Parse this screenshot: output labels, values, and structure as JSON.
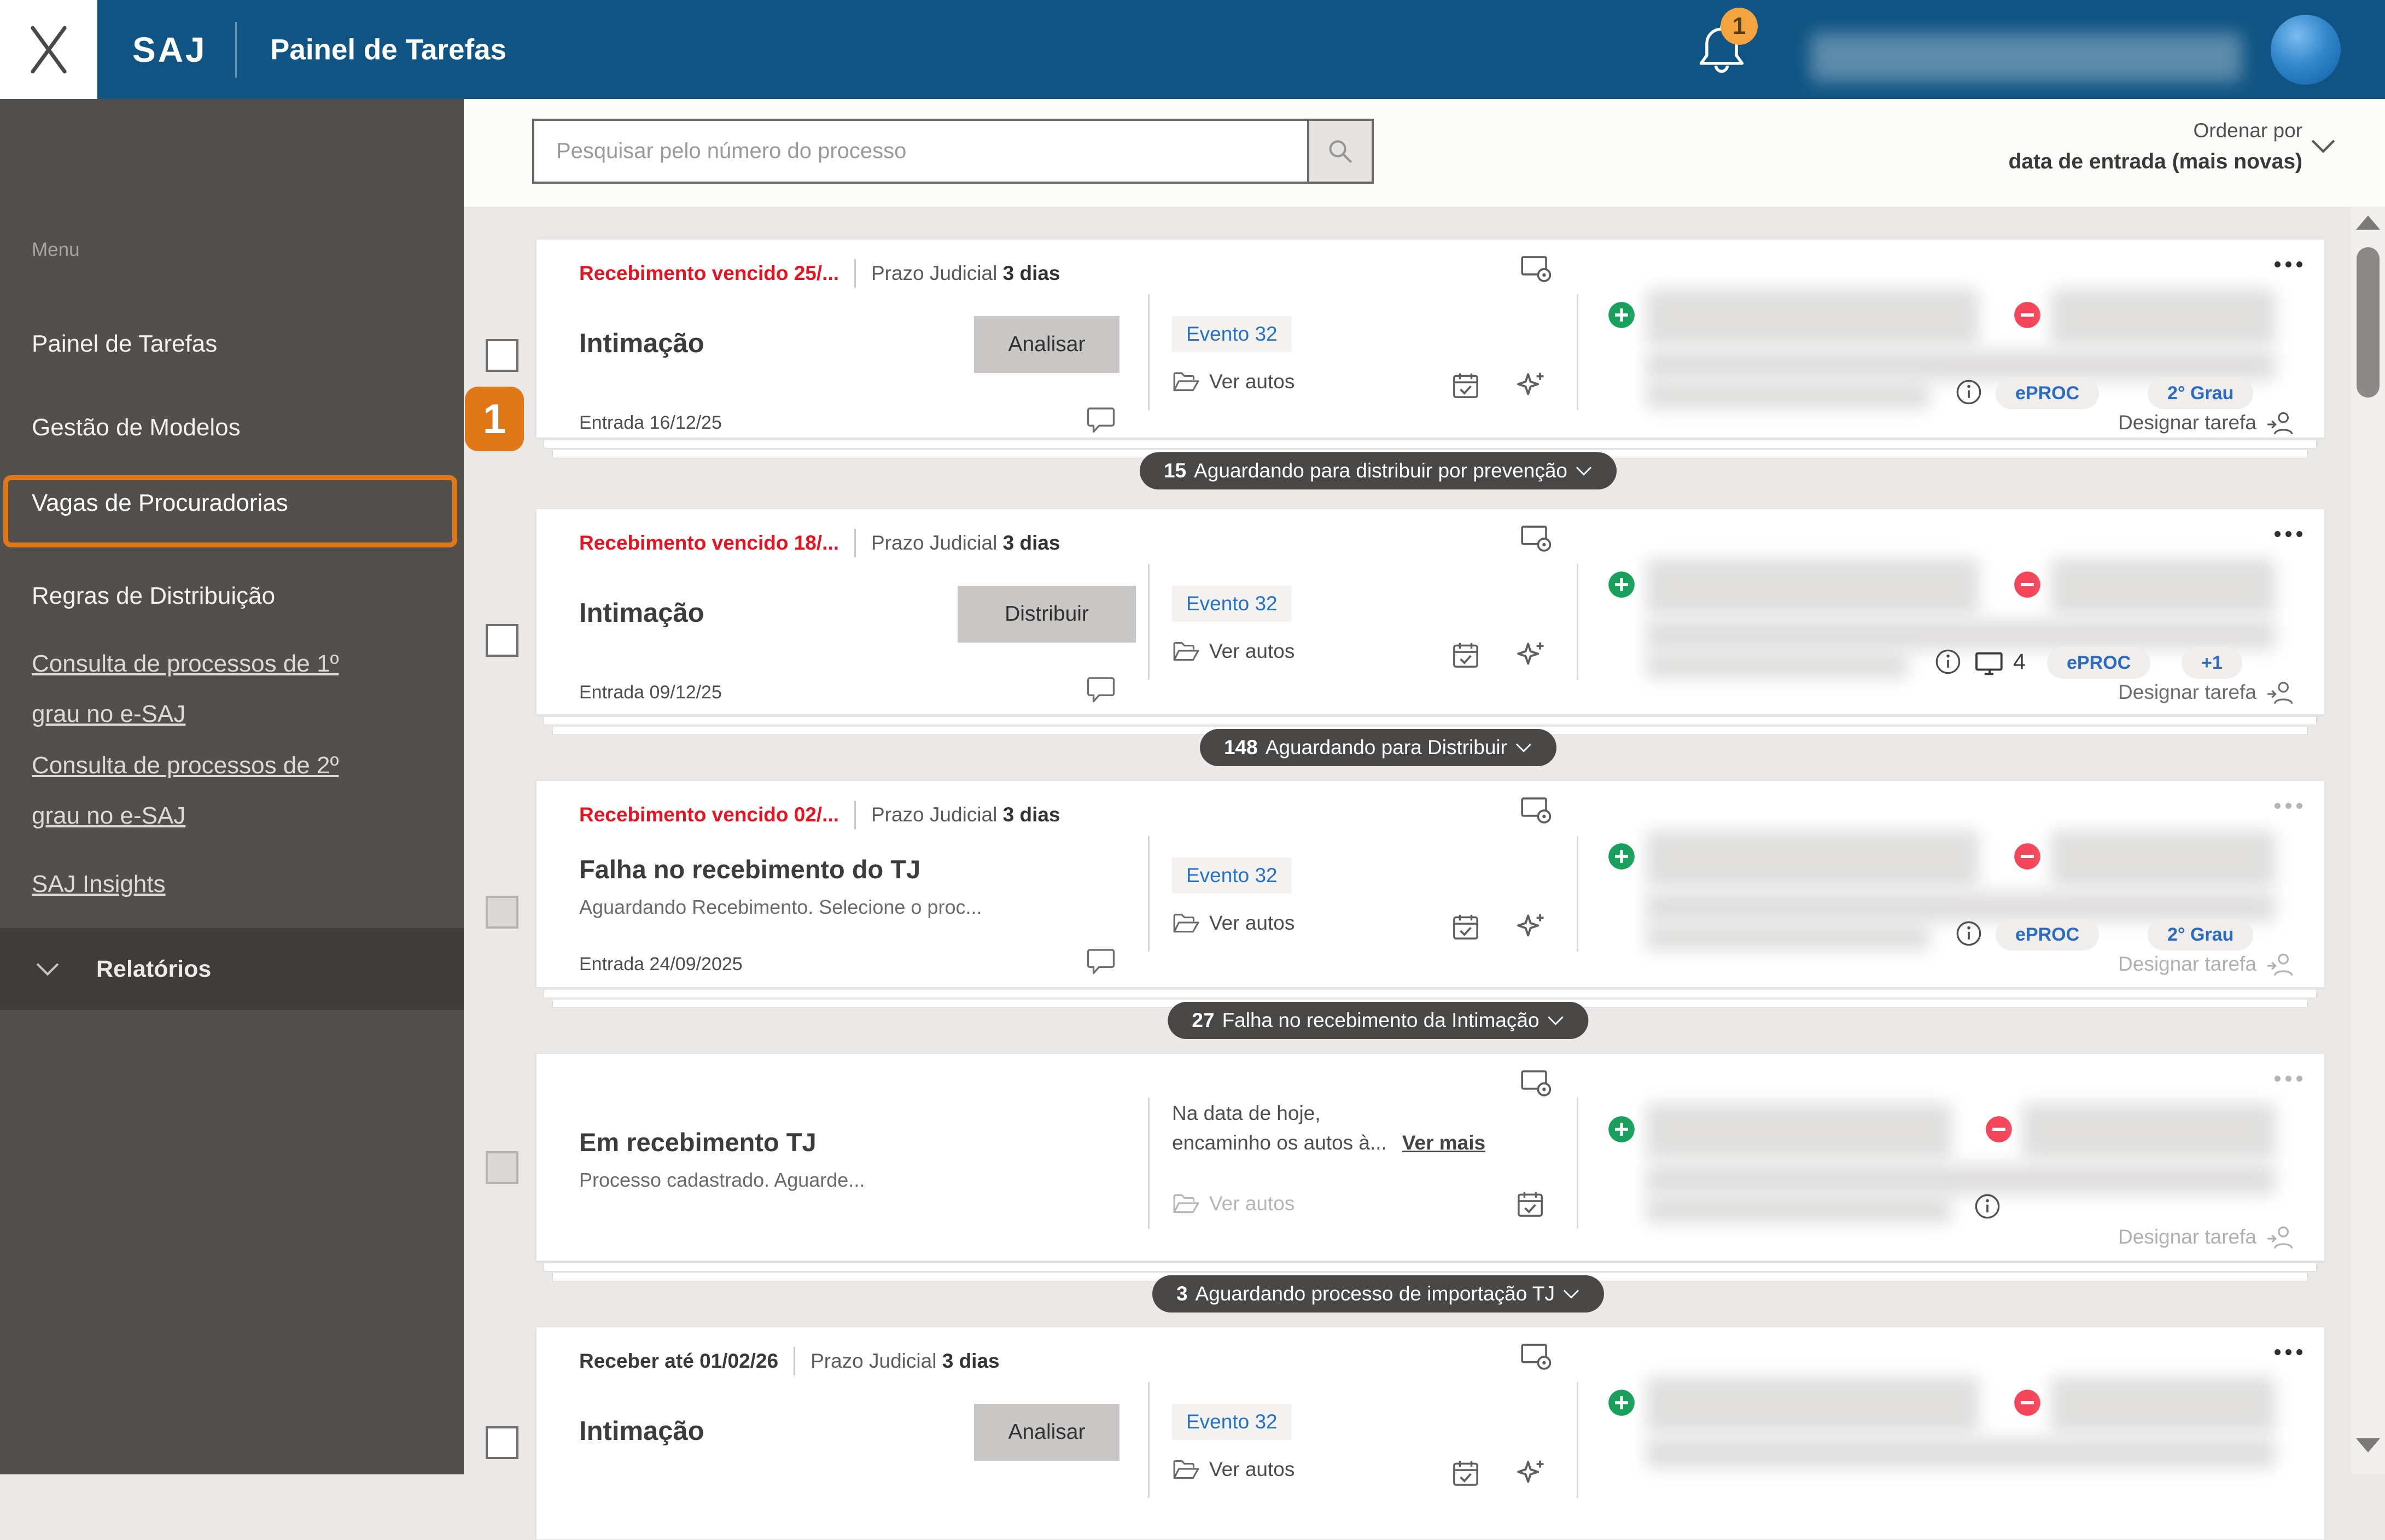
{
  "colors": {
    "topbar_blue": "#0f5483",
    "sidebar_gray": "#524f4d",
    "highlight_orange": "#e0781a",
    "deadline_red": "#e31523",
    "link_blue": "#2372c8",
    "badge_green": "#18a05c",
    "badge_red": "#f4465a",
    "group_pill_dark": "#4a4747",
    "notification_orange": "#f3a43e"
  },
  "header": {
    "logo": "SAJ",
    "title": "Painel de Tarefas",
    "notification_count": "1"
  },
  "sidebar": {
    "menu_label": "Menu",
    "items": [
      {
        "label": "Painel de Tarefas"
      },
      {
        "label": "Gestão de Modelos"
      },
      {
        "label": "Vagas de Procuradorias",
        "highlighted": true,
        "annotation": "1"
      },
      {
        "label": "Regras de Distribuição"
      },
      {
        "label": "Consulta de processos de 1º grau no e-SAJ"
      },
      {
        "label": "Consulta de processos de 2º grau no e-SAJ"
      },
      {
        "label": "SAJ Insights"
      }
    ],
    "reports_label": "Relatórios"
  },
  "toolbar": {
    "search_placeholder": "Pesquisar pelo número do processo",
    "sort_label": "Ordenar por",
    "sort_value": "data de entrada (mais novas)"
  },
  "cards": [
    {
      "deadline": "Recebimento vencido 25/...",
      "prazo_label": "Prazo Judicial",
      "prazo_value": "3 dias",
      "title": "Intimação",
      "action": "Analisar",
      "event": "Evento 32",
      "ver_autos": "Ver autos",
      "entrada": "Entrada 16/12/25",
      "badges": [
        "ePROC",
        "2° Grau"
      ],
      "designar": "Designar tarefa",
      "group": {
        "count": "15",
        "label": "Aguardando para distribuir por prevenção"
      }
    },
    {
      "deadline": "Recebimento vencido 18/...",
      "prazo_label": "Prazo Judicial",
      "prazo_value": "3 dias",
      "title": "Intimação",
      "action": "Distribuir",
      "event": "Evento 32",
      "ver_autos": "Ver autos",
      "entrada": "Entrada 09/12/25",
      "monitor_count": "4",
      "badges": [
        "ePROC",
        "+1"
      ],
      "designar": "Designar tarefa",
      "group": {
        "count": "148",
        "label": "Aguardando para Distribuir"
      }
    },
    {
      "deadline": "Recebimento vencido 02/...",
      "prazo_label": "Prazo Judicial",
      "prazo_value": "3 dias",
      "title": "Falha no recebimento do TJ",
      "subtitle": "Aguardando Recebimento. Selecione o proc...",
      "event": "Evento 32",
      "ver_autos": "Ver autos",
      "entrada": "Entrada 24/09/2025",
      "badges": [
        "ePROC",
        "2° Grau"
      ],
      "designar": "Designar tarefa",
      "group": {
        "count": "27",
        "label": "Falha no recebimento da Intimação"
      }
    },
    {
      "title": "Em recebimento TJ",
      "subtitle": "Processo cadastrado. Aguarde...",
      "note_line1": "Na data de hoje,",
      "note_line2": "encaminho os autos à...",
      "ver_mais": "Ver mais",
      "ver_autos": "Ver autos",
      "designar": "Designar tarefa",
      "group": {
        "count": "3",
        "label": "Aguardando processo de importação TJ"
      }
    },
    {
      "deadline": "Receber até 01/02/26",
      "prazo_label": "Prazo Judicial",
      "prazo_value": "3 dias",
      "title": "Intimação",
      "action": "Analisar",
      "event": "Evento 32",
      "ver_autos": "Ver autos"
    }
  ]
}
